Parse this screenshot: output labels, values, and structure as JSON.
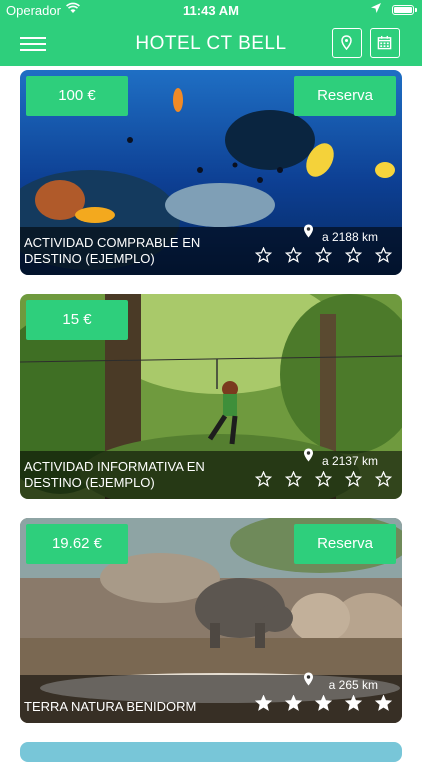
{
  "status_bar": {
    "carrier": "Operador",
    "time": "11:43 AM"
  },
  "header": {
    "title": "HOTEL CT BELL",
    "menu_icon": "hamburger-menu-icon",
    "map_icon": "map-pin-icon",
    "calendar_icon": "calendar-icon"
  },
  "colors": {
    "brand": "#2ecf7c",
    "overlay": "rgba(0,0,0,0.55)",
    "text": "#ffffff"
  },
  "activities": [
    {
      "name": "ACTIVIDAD COMPRABLE EN DESTINO (EJEMPLO)",
      "price": "100 €",
      "reserve_label": "Reserva",
      "distance": "a 2188 km",
      "rating": 0,
      "rating_max": 5
    },
    {
      "name": "ACTIVIDAD INFORMATIVA EN DESTINO (EJEMPLO)",
      "price": "15 €",
      "reserve_label": "",
      "distance": "a 2137 km",
      "rating": 0,
      "rating_max": 5
    },
    {
      "name": "TERRA NATURA BENIDORM",
      "price": "19.62 €",
      "reserve_label": "Reserva",
      "distance": "a 265 km",
      "rating": 5,
      "rating_max": 5
    }
  ]
}
